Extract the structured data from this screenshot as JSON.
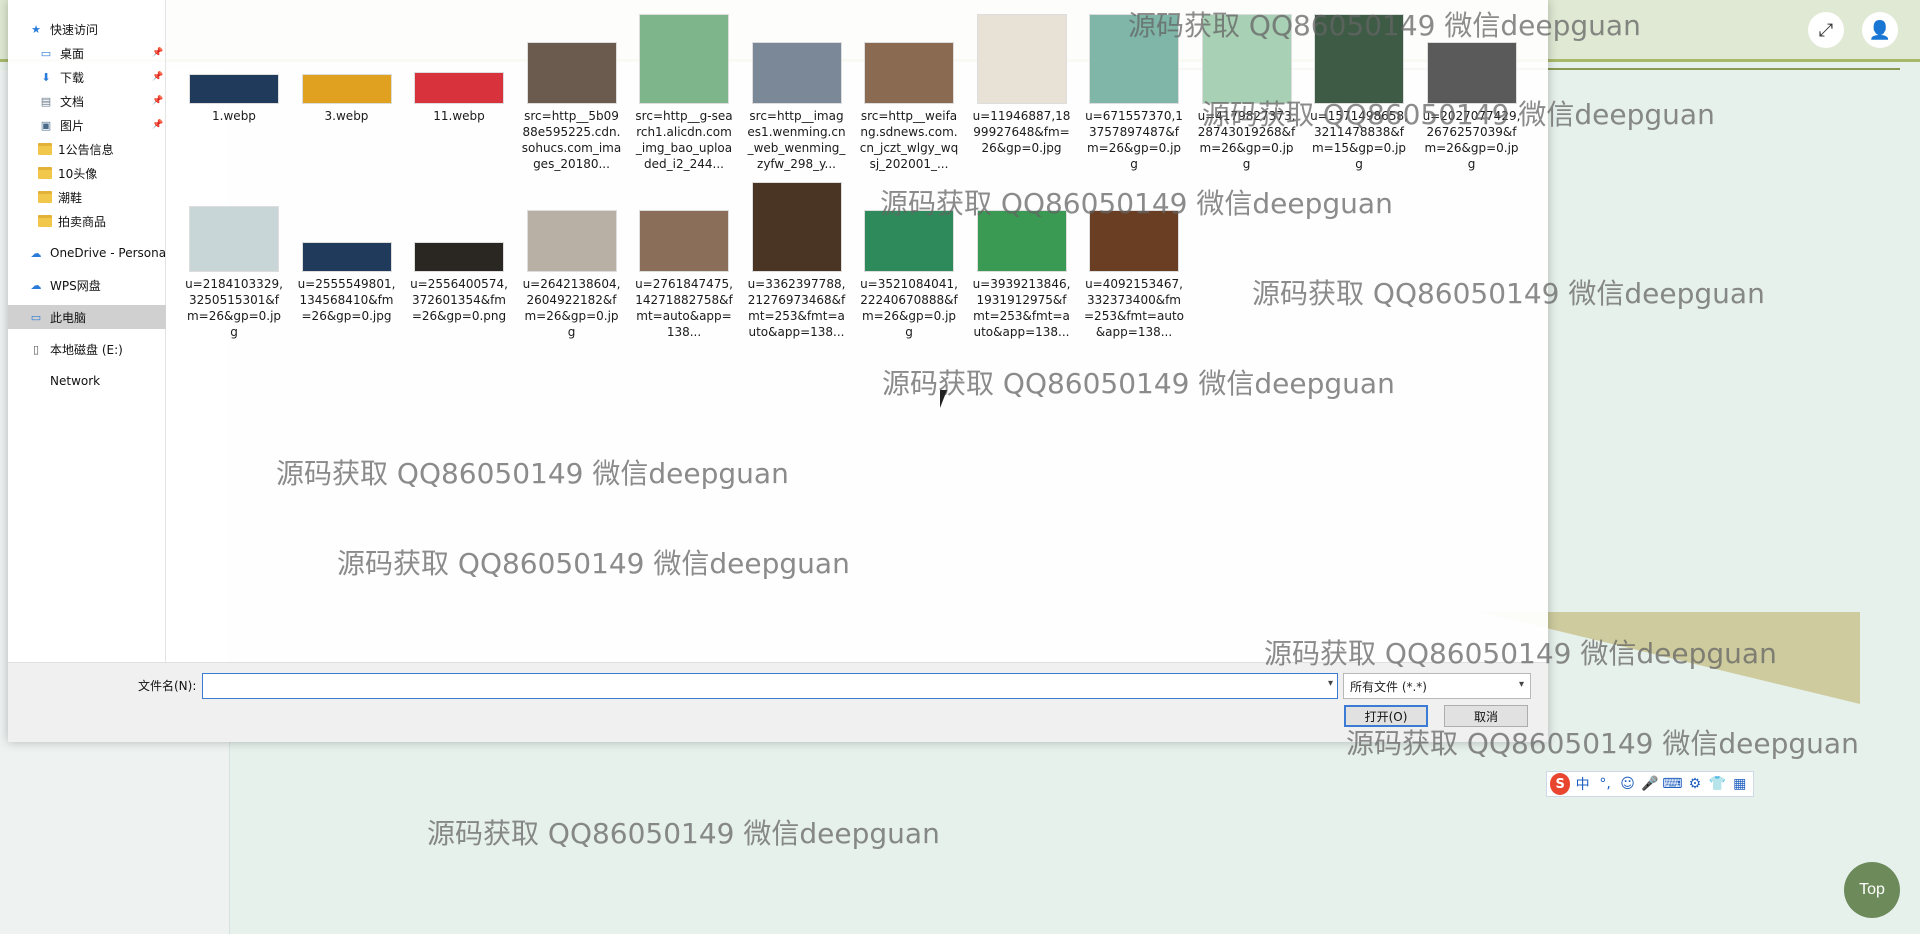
{
  "background_page": {
    "top_button_label": "Top"
  },
  "nav": {
    "items": [
      {
        "label": "快速访问",
        "icon": "star-icon",
        "pinned": false
      },
      {
        "label": "桌面",
        "icon": "desktop-icon",
        "pinned": true
      },
      {
        "label": "下载",
        "icon": "download-icon",
        "pinned": true
      },
      {
        "label": "文档",
        "icon": "document-icon",
        "pinned": true
      },
      {
        "label": "图片",
        "icon": "picture-icon",
        "pinned": true
      },
      {
        "label": "1公告信息",
        "icon": "folder-icon",
        "pinned": false
      },
      {
        "label": "10头像",
        "icon": "folder-icon",
        "pinned": false
      },
      {
        "label": "潮鞋",
        "icon": "folder-icon",
        "pinned": false
      },
      {
        "label": "拍卖商品",
        "icon": "folder-icon",
        "pinned": false
      },
      {
        "label": "OneDrive - Persona",
        "icon": "cloud-icon",
        "pinned": false
      },
      {
        "label": "WPS网盘",
        "icon": "cloud-icon",
        "pinned": false
      },
      {
        "label": "此电脑",
        "icon": "computer-icon",
        "pinned": false
      },
      {
        "label": "本地磁盘 (E:)",
        "icon": "drive-icon",
        "pinned": false
      },
      {
        "label": "Network",
        "icon": "network-icon",
        "pinned": false
      }
    ]
  },
  "files": [
    {
      "name": "1.webp",
      "color": "#1f3a5a"
    },
    {
      "name": "3.webp",
      "color": "#e0a020"
    },
    {
      "name": "11.webp",
      "color": "#d8323c"
    },
    {
      "name": "src=http__5b0988e595225.cdn.sohucs.com_images_20180...",
      "color": "#6b5a4e"
    },
    {
      "name": "src=http__g-search1.alicdn.com_img_bao_uploaded_i2_244...",
      "color": "#7fb58a"
    },
    {
      "name": "src=http__images1.wenming.cn_web_wenming_zyfw_298_y...",
      "color": "#7a8898"
    },
    {
      "name": "src=http__weifang.sdnews.com.cn_jczt_wlgy_wqsj_202001_...",
      "color": "#8a6a50"
    },
    {
      "name": "u=11946887,1899927648&fm=26&gp=0.jpg",
      "color": "#e8e2d6"
    },
    {
      "name": "u=671557370,13757897487&fm=26&gp=0.jpg",
      "color": "#7fb6a8"
    },
    {
      "name": "u=4179827373,28743019268&fm=26&gp=0.jpg",
      "color": "#a8d0b4"
    },
    {
      "name": "u=1571498658,3211478838&fm=15&gp=0.jpg",
      "color": "#3e5b46"
    },
    {
      "name": "u=2027077429,2676257039&fm=26&gp=0.jpg",
      "color": "#5a5a5a"
    },
    {
      "name": "u=2184103329,3250515301&fm=26&gp=0.jpg",
      "color": "#c8d6d8"
    },
    {
      "name": "u=2555549801,134568410&fm=26&gp=0.jpg",
      "color": "#1f3a5a"
    },
    {
      "name": "u=2556400574,372601354&fm=26&gp=0.png",
      "color": "#2a2622"
    },
    {
      "name": "u=2642138604,2604922182&fm=26&gp=0.jpg",
      "color": "#b8b0a4"
    },
    {
      "name": "u=2761847475,14271882758&fmt=auto&app=138...",
      "color": "#8a6e5a"
    },
    {
      "name": "u=3362397788,21276973468&fmt=253&fmt=auto&app=138...",
      "color": "#4a3424"
    },
    {
      "name": "u=3521084041,22240670888&fm=26&gp=0.jpg",
      "color": "#2e8a5a"
    },
    {
      "name": "u=3939213846,1931912975&fmt=253&fmt=auto&app=138...",
      "color": "#3a9a54"
    },
    {
      "name": "u=4092153467,332373400&fm=253&fmt=auto&app=138...",
      "color": "#6a3e22"
    }
  ],
  "bottom": {
    "filename_label": "文件名(N):",
    "filename_value": "",
    "filetype_value": "所有文件 (*.*)",
    "open_label": "打开(O)",
    "cancel_label": "取消"
  },
  "ime": {
    "logo": "S",
    "items": [
      "中",
      "°,",
      "☺",
      "🎤",
      "⌨",
      "⚙",
      "👕",
      "▦"
    ]
  },
  "watermark": "源码获取 QQ86050149 微信deepguan"
}
